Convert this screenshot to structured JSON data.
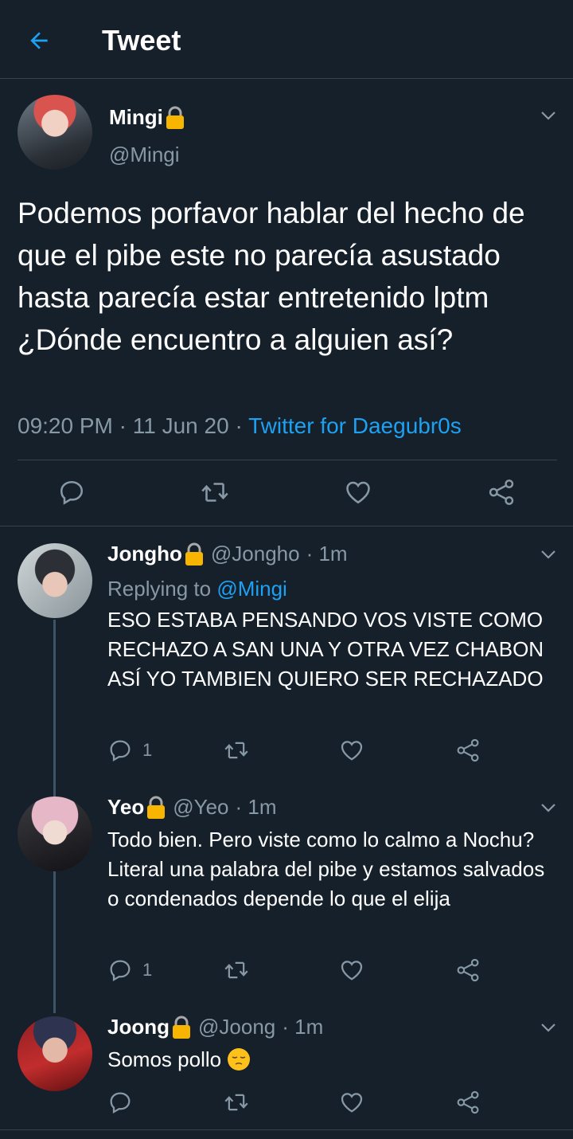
{
  "header": {
    "title": "Tweet",
    "back_icon": "arrow-left-icon"
  },
  "main_tweet": {
    "name": "Mingi",
    "handle": "@Mingi",
    "text": "Podemos porfavor hablar del hecho de que el pibe este no parecía asustado hasta parecía estar entretenido lptm ¿Dónde encuentro a alguien así?",
    "time": "09:20 PM",
    "date": "11 Jun 20",
    "separator": " · ",
    "source": "Twitter for Daegubr0s"
  },
  "replies": [
    {
      "name": "Jongho",
      "handle": "@Jongho",
      "time": "· 1m",
      "replying_prefix": "Replying to ",
      "replying_to": "@Mingi",
      "text": "ESO ESTABA PENSANDO VOS VISTE COMO RECHAZO A SAN UNA Y OTRA VEZ CHABON ASÍ YO TAMBIEN QUIERO SER RECHAZADO",
      "reply_count": "1"
    },
    {
      "name": "Yeo",
      "handle": "@Yeo",
      "time": "· 1m",
      "text": "Todo bien. Pero viste como lo calmo a Nochu? Literal una palabra del pibe y estamos salvados o condenados depende lo que el elija",
      "reply_count": "1"
    },
    {
      "name": "Joong",
      "handle": "@Joong",
      "time": "· 1m",
      "text": "Somos pollo",
      "emoji": "pensive-face-emoji"
    }
  ],
  "colors": {
    "background": "#15202b",
    "text": "#ffffff",
    "muted": "#8899a6",
    "accent": "#1da1f2",
    "border": "#38444d"
  }
}
